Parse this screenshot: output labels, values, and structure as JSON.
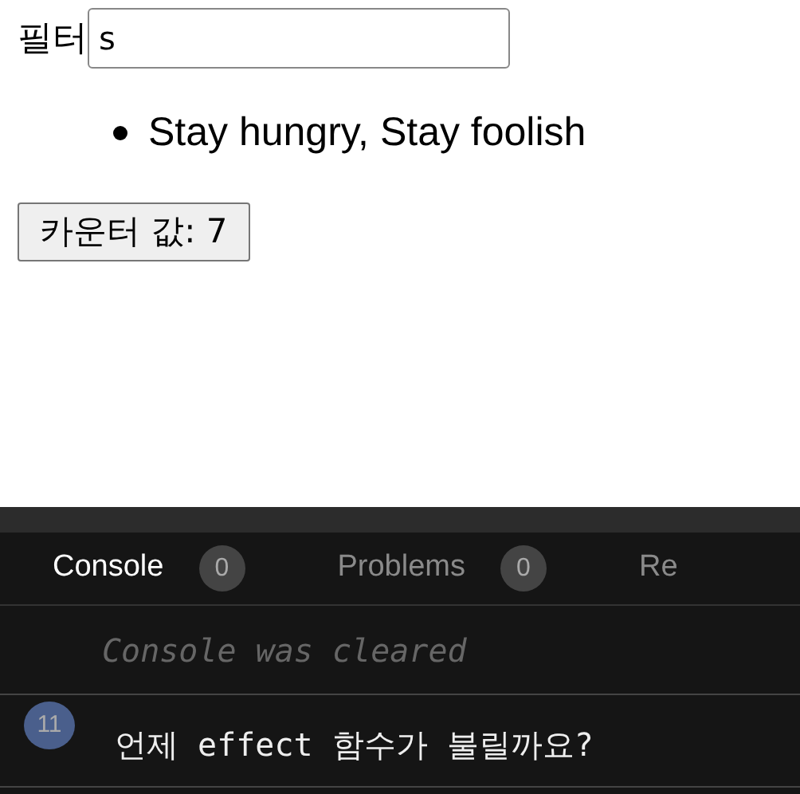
{
  "filter": {
    "label": "필터",
    "value": "s"
  },
  "items": [
    "Stay hungry, Stay foolish"
  ],
  "counter_button": "카운터 값: 7",
  "console": {
    "tabs": [
      {
        "label": "Console",
        "count": "0",
        "selected": true
      },
      {
        "label": "Problems",
        "count": "0",
        "selected": false
      },
      {
        "label": "Re",
        "selected": false
      }
    ],
    "entries": [
      {
        "kind": "info",
        "text": "Console was cleared"
      },
      {
        "kind": "log",
        "count": "11",
        "text": "언제 effect 함수가 불릴까요?"
      }
    ]
  }
}
